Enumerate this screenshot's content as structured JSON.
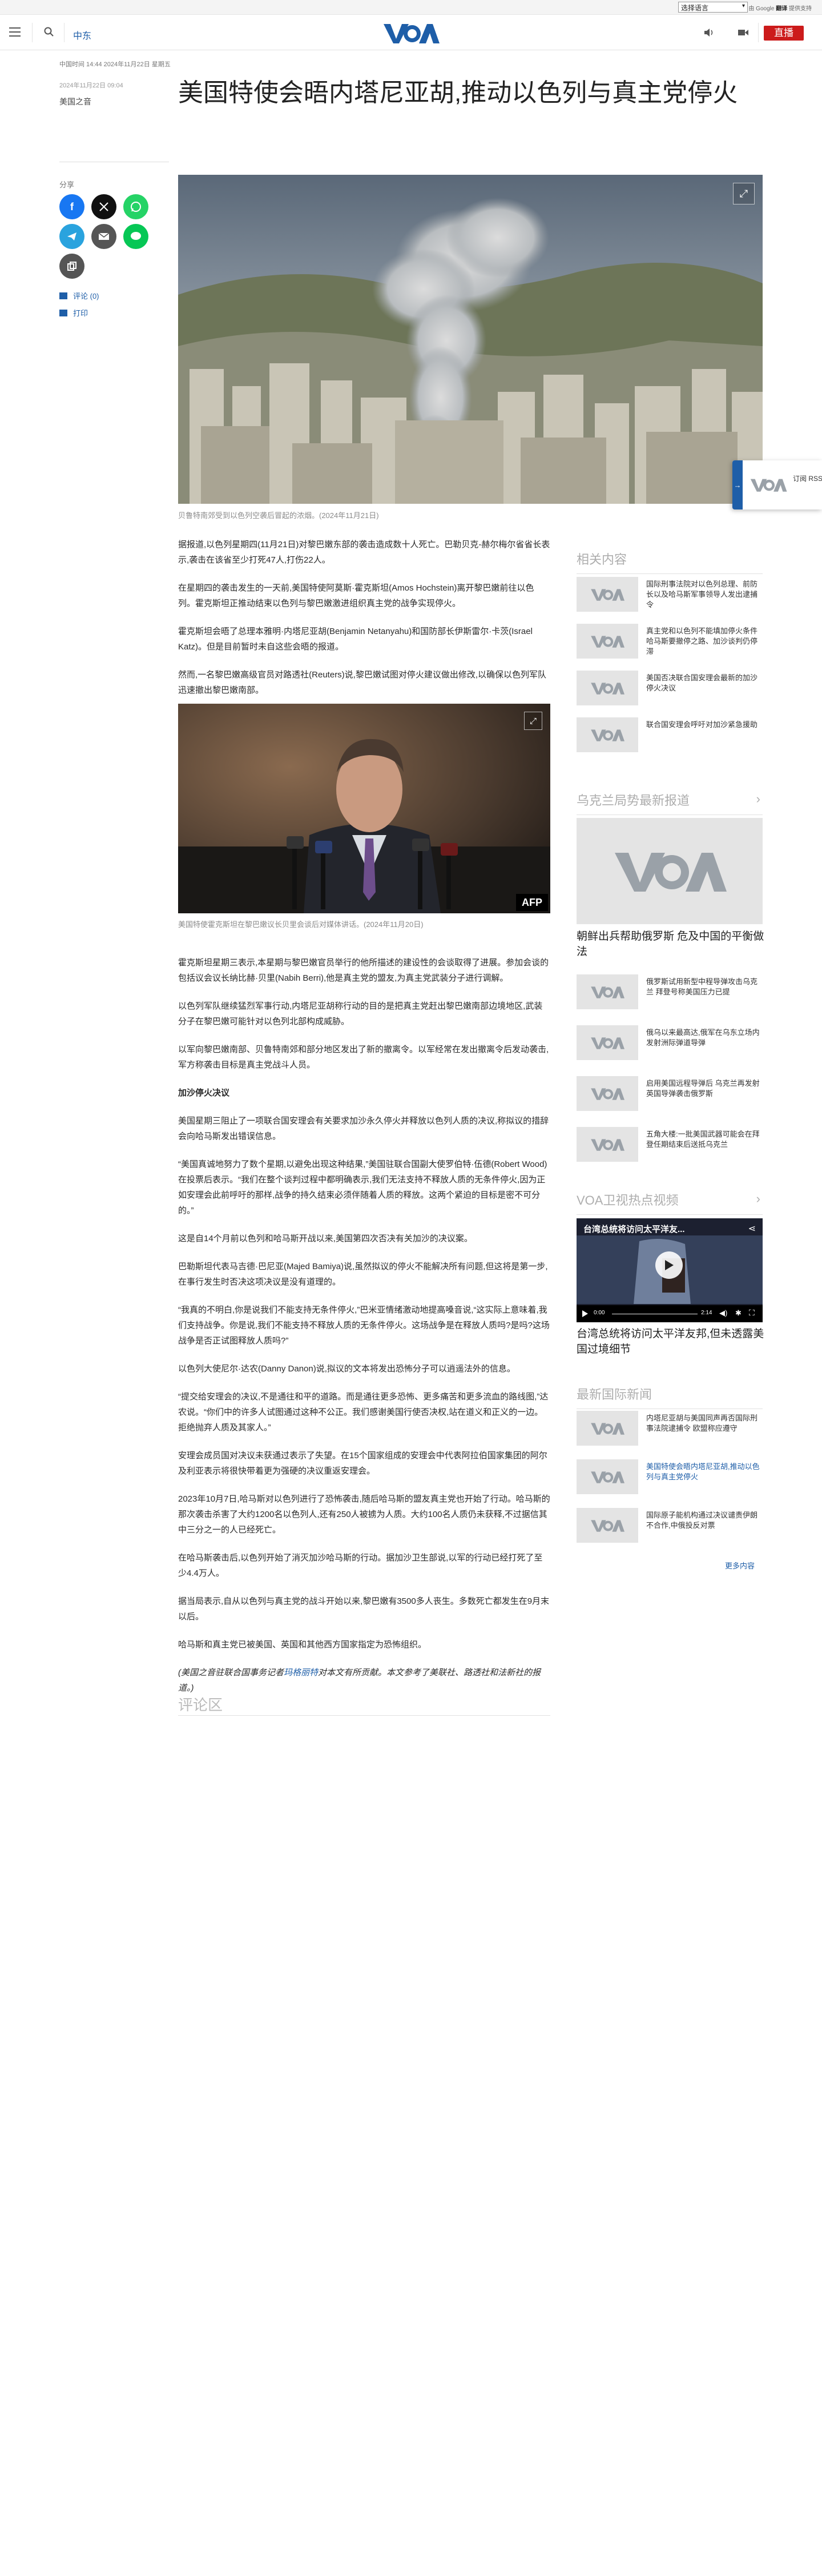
{
  "topbar": {
    "language_select": "选择语言",
    "powered_by": "由 Google",
    "translate": "翻译",
    "powered_suffix": "提供支持"
  },
  "header": {
    "section": "中东",
    "live": "直播"
  },
  "article": {
    "updated": "中国时间 14:44 2024年11月22日 星期五",
    "dates": "2024年11月22日 09:04",
    "category": "美国之音",
    "title": "美国特使会晤内塔尼亚胡,推动以色列与真主党停火",
    "hero_caption": "贝鲁特南郊受到以色列空袭后冒起的浓烟。(2024年11月21日)",
    "inline_caption": "美国特使霍克斯坦在黎巴嫩议长贝里会谈后对媒体讲话。(2024年11月20日)",
    "paragraphs_a": [
      "据报道,以色列星期四(11月21日)对黎巴嫩东部的袭击造成数十人死亡。巴勒贝克-赫尔梅尔省省长表示,袭击在该省至少打死47人,打伤22人。",
      "在星期四的袭击发生的一天前,美国特使阿莫斯·霍克斯坦(Amos Hochstein)离开黎巴嫩前往以色列。霍克斯坦正推动结束以色列与黎巴嫩激进组织真主党的战争实现停火。",
      "霍克斯坦会晤了总理本雅明·内塔尼亚胡(Benjamin Netanyahu)和国防部长伊斯雷尔·卡茨(Israel Katz)。但是目前暂时未自这些会晤的报道。",
      "然而,一名黎巴嫩高级官员对路透社(Reuters)说,黎巴嫩试图对停火建议做出修改,以确保以色列军队迅速撤出黎巴嫩南部。"
    ],
    "paragraphs_b": [
      "霍克斯坦星期三表示,本星期与黎巴嫩官员举行的他所描述的建设性的会谈取得了进展。参加会谈的包括议会议长纳比赫·贝里(Nabih Berri),他是真主党的盟友,为真主党武装分子进行调解。",
      "以色列军队继续猛烈军事行动,内塔尼亚胡称行动的目的是把真主党赶出黎巴嫩南部边境地区,武装分子在黎巴嫩可能针对以色列北部构成威胁。",
      "以军向黎巴嫩南部、贝鲁特南郊和部分地区发出了新的撤离令。以军经常在发出撤离令后发动袭击,军方称袭击目标是真主党战斗人员。"
    ],
    "subhead": "加沙停火决议",
    "paragraphs_c": [
      "美国星期三阻止了一项联合国安理会有关要求加沙永久停火并释放以色列人质的决议,称拟议的措辞会向哈马斯发出错误信息。",
      "“美国真诚地努力了数个星期,以避免出现这种结果,”美国驻联合国副大使罗伯特·伍德(Robert Wood)在投票后表示。“我们在整个谈判过程中都明确表示,我们无法支持不释放人质的无条件停火,因为正如安理会此前呼吁的那样,战争的持久结束必须伴随着人质的释放。这两个紧迫的目标是密不可分的。”",
      "这是自14个月前以色列和哈马斯开战以来,美国第四次否决有关加沙的决议案。",
      "巴勒斯坦代表马吉德·巴尼亚(Majed Bamiya)说,虽然拟议的停火不能解决所有问题,但这将是第一步,在事行发生时否决这项决议是没有道理的。",
      "“我真的不明白,你是说我们不能支持无条件停火,”巴米亚情绪激动地提高嗓音说,“这实际上意味着,我们支持战争。你是说,我们不能支持不释放人质的无条件停火。这场战争是在释放人质吗?是吗?这场战争是否正试图释放人质吗?”",
      "以色列大使尼尔·达农(Danny Danon)说,拟议的文本将发出恐怖分子可以逍遥法外的信息。",
      "“提交给安理会的决议,不是通往和平的道路。而是通往更多恐怖、更多痛苦和更多流血的路线图,”达农说。“你们中的许多人试图通过这种不公正。我们感谢美国行使否决权,站在道义和正义的一边。拒绝抛弃人质及其家人。”",
      "安理会成员国对决议未获通过表示了失望。在15个国家组成的安理会中代表阿拉伯国家集团的阿尔及利亚表示将很快带着更为强硬的决议重返安理会。",
      "2023年10月7日,哈马斯对以色列进行了恐怖袭击,随后哈马斯的盟友真主党也开始了行动。哈马斯的那次袭击杀害了大约1200名以色列人,还有250人被掳为人质。大约100名人质仍未获释,不过据信其中三分之一的人已经死亡。",
      "在哈马斯袭击后,以色列开始了消灭加沙哈马斯的行动。据加沙卫生部说,以军的行动已经打死了至少4.4万人。",
      "据当局表示,自从以色列与真主党的战斗开始以来,黎巴嫩有3500多人丧生。多数死亡都发生在9月末以后。",
      "哈马斯和真主党已被美国、英国和其他西方国家指定为恐怖组织。"
    ],
    "byline_prefix": "(美国之音驻联合国事务记者",
    "byline_name": "玛格丽特",
    "byline_suffix": "对本文有所贡献。本文参考了美联社、路透社和法新社的报道。)",
    "comments": "评论区"
  },
  "share": {
    "label": "分享",
    "comments_link": "评论 (0)",
    "print_link": "打印"
  },
  "related": {
    "title": "相关内容",
    "items": [
      "国际刑事法院对以色列总理、前防长以及哈马斯军事领导人发出逮捕令",
      "真主党和以色列不能填加停火条件 哈马斯要撤停之路、加沙谈判仍停滞",
      "美国否决联合国安理会最新的加沙停火决议",
      "联合国安理会呼吁对加沙紧急援助"
    ]
  },
  "ukraine": {
    "title": "乌克兰局势最新报道",
    "feature_title": "朝鲜出兵帮助俄罗斯 危及中国的平衡做法",
    "items": [
      "俄罗斯试用新型中程导弹攻击乌克兰 拜登号称美国压力已提",
      "俄乌以来最高达,俄军在乌东立场内发射洲际弹道导弹",
      "启用美国远程导弹后 乌克兰再发射英国导弹袭击俄罗斯",
      "五角大楼:一批美国武器可能会在拜登任期结束后送抵乌克兰"
    ]
  },
  "video": {
    "title": "VOA卫视热点视频",
    "overlay_title": "台湾总统将访问太平洋友...",
    "time": "0:00",
    "duration": "2:14",
    "caption": "台湾总统将访问太平洋友邦,但未透露美国过境细节"
  },
  "latest": {
    "title": "最新国际新闻",
    "items": [
      "内塔尼亚胡与美国同声再否国际刑事法院逮捕令 欧盟称应遵守",
      "美国特使会晤内塔尼亚胡,推动以色列与真主党停火",
      "国际原子能机构通过决议谴责伊朗不合作,中俄投反对票"
    ],
    "more": "更多内容"
  },
  "float_tab": {
    "text": "订阅 RSS",
    "arrow": "→"
  },
  "colors": {
    "brand_blue": "#1e5ea8",
    "live_red": "#cc1b1b",
    "facebook": "#1877f2",
    "x": "#111111",
    "whatsapp": "#25d366",
    "telegram": "#2aa3de",
    "email": "#555555",
    "line": "#06c755",
    "copy": "#555555"
  },
  "icons": [
    "hamburger-icon",
    "search-icon",
    "voa-logo",
    "audio-icon",
    "video-icon",
    "expand-icon",
    "comment-icon",
    "print-icon",
    "play-icon",
    "share-icon",
    "fullscreen-icon",
    "settings-icon",
    "volume-icon",
    "chevron-right-icon"
  ]
}
